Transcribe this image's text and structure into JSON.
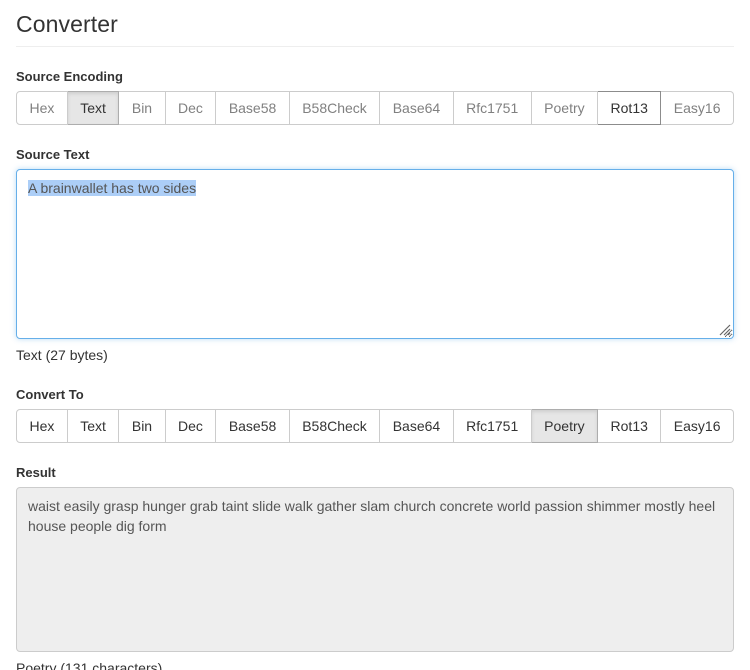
{
  "page": {
    "title": "Converter"
  },
  "source_encoding": {
    "label": "Source Encoding",
    "options": [
      {
        "label": "Hex",
        "state": "normal"
      },
      {
        "label": "Text",
        "state": "active"
      },
      {
        "label": "Bin",
        "state": "normal"
      },
      {
        "label": "Dec",
        "state": "normal"
      },
      {
        "label": "Base58",
        "state": "normal"
      },
      {
        "label": "B58Check",
        "state": "normal"
      },
      {
        "label": "Base64",
        "state": "normal"
      },
      {
        "label": "Rfc1751",
        "state": "normal"
      },
      {
        "label": "Poetry",
        "state": "normal"
      },
      {
        "label": "Rot13",
        "state": "focused"
      },
      {
        "label": "Easy16",
        "state": "normal"
      }
    ],
    "selected": "Text",
    "focused": "Rot13"
  },
  "source_text": {
    "label": "Source Text",
    "value": "A brainwallet has two sides",
    "placeholder": "",
    "selected": true,
    "focused": true,
    "help": "Text (27 bytes)",
    "format_name": "Text",
    "byte_count": 27
  },
  "convert_to": {
    "label": "Convert To",
    "options": [
      {
        "label": "Hex",
        "state": "normal"
      },
      {
        "label": "Text",
        "state": "normal"
      },
      {
        "label": "Bin",
        "state": "normal"
      },
      {
        "label": "Dec",
        "state": "normal"
      },
      {
        "label": "Base58",
        "state": "normal"
      },
      {
        "label": "B58Check",
        "state": "normal"
      },
      {
        "label": "Base64",
        "state": "normal"
      },
      {
        "label": "Rfc1751",
        "state": "normal"
      },
      {
        "label": "Poetry",
        "state": "active"
      },
      {
        "label": "Rot13",
        "state": "normal"
      },
      {
        "label": "Easy16",
        "state": "normal"
      }
    ],
    "selected": "Poetry"
  },
  "result": {
    "label": "Result",
    "value": "waist easily grasp hunger grab taint slide walk gather slam church concrete world passion shimmer mostly heel house people dig form",
    "help": "Poetry (131 characters)",
    "format_name": "Poetry",
    "character_count": 131,
    "readonly": true
  },
  "colors": {
    "focus_border": "#66afe9",
    "selection_highlight": "#accef7",
    "active_button_bg": "#e6e6e6",
    "border": "#cccccc",
    "readonly_bg": "#eeeeee",
    "text": "#333333",
    "muted_text": "#808080"
  }
}
